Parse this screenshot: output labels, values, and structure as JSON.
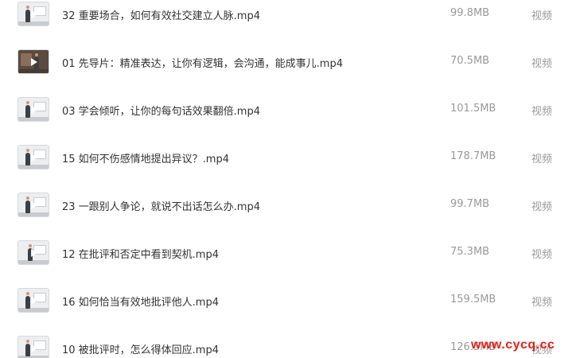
{
  "files": [
    {
      "name": "32 重要场合，如何有效社交建立人脉.mp4",
      "size": "99.8MB",
      "type": "视频",
      "thumb": "light"
    },
    {
      "name": "01 先导片：精准表达，让你有逻辑，会沟通，能成事儿.mp4",
      "size": "70.5MB",
      "type": "视频",
      "thumb": "dark"
    },
    {
      "name": "03 学会倾听，让你的每句话效果翻倍.mp4",
      "size": "101.5MB",
      "type": "视频",
      "thumb": "light"
    },
    {
      "name": "15 如何不伤感情地提出异议？.mp4",
      "size": "178.7MB",
      "type": "视频",
      "thumb": "light"
    },
    {
      "name": "23 一跟别人争论，就说不出话怎么办.mp4",
      "size": "99.7MB",
      "type": "视频",
      "thumb": "light"
    },
    {
      "name": "12 在批评和否定中看到契机.mp4",
      "size": "75.3MB",
      "type": "视频",
      "thumb": "light"
    },
    {
      "name": "16 如何恰当有效地批评他人.mp4",
      "size": "159.5MB",
      "type": "视频",
      "thumb": "light"
    },
    {
      "name": "10 被批评时，怎么得体回应.mp4",
      "size": "126.5MB",
      "type": "视频",
      "thumb": "light"
    }
  ],
  "watermark": "www.cycq.cc",
  "colors": {
    "name_text": "#333333",
    "meta_text": "#999999",
    "watermark": "#e8211a"
  }
}
